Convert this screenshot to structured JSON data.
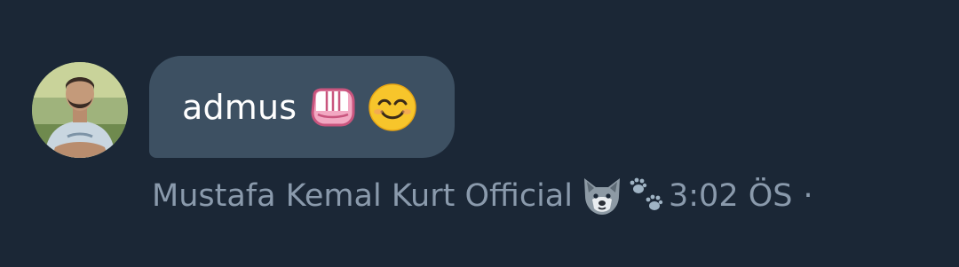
{
  "message": {
    "text": "admus",
    "emojis": [
      "oncoming-fist-icon",
      "smiling-face-icon"
    ],
    "sender": "Mustafa Kemal Kurt Official",
    "sender_emojis": [
      "wolf-face-icon",
      "paw-prints-icon"
    ],
    "time": "3:02 ÖS",
    "separator": "·"
  },
  "colors": {
    "background": "#1b2736",
    "bubble": "#3d5062",
    "text": "#ffffff",
    "meta": "#8a9aac"
  }
}
